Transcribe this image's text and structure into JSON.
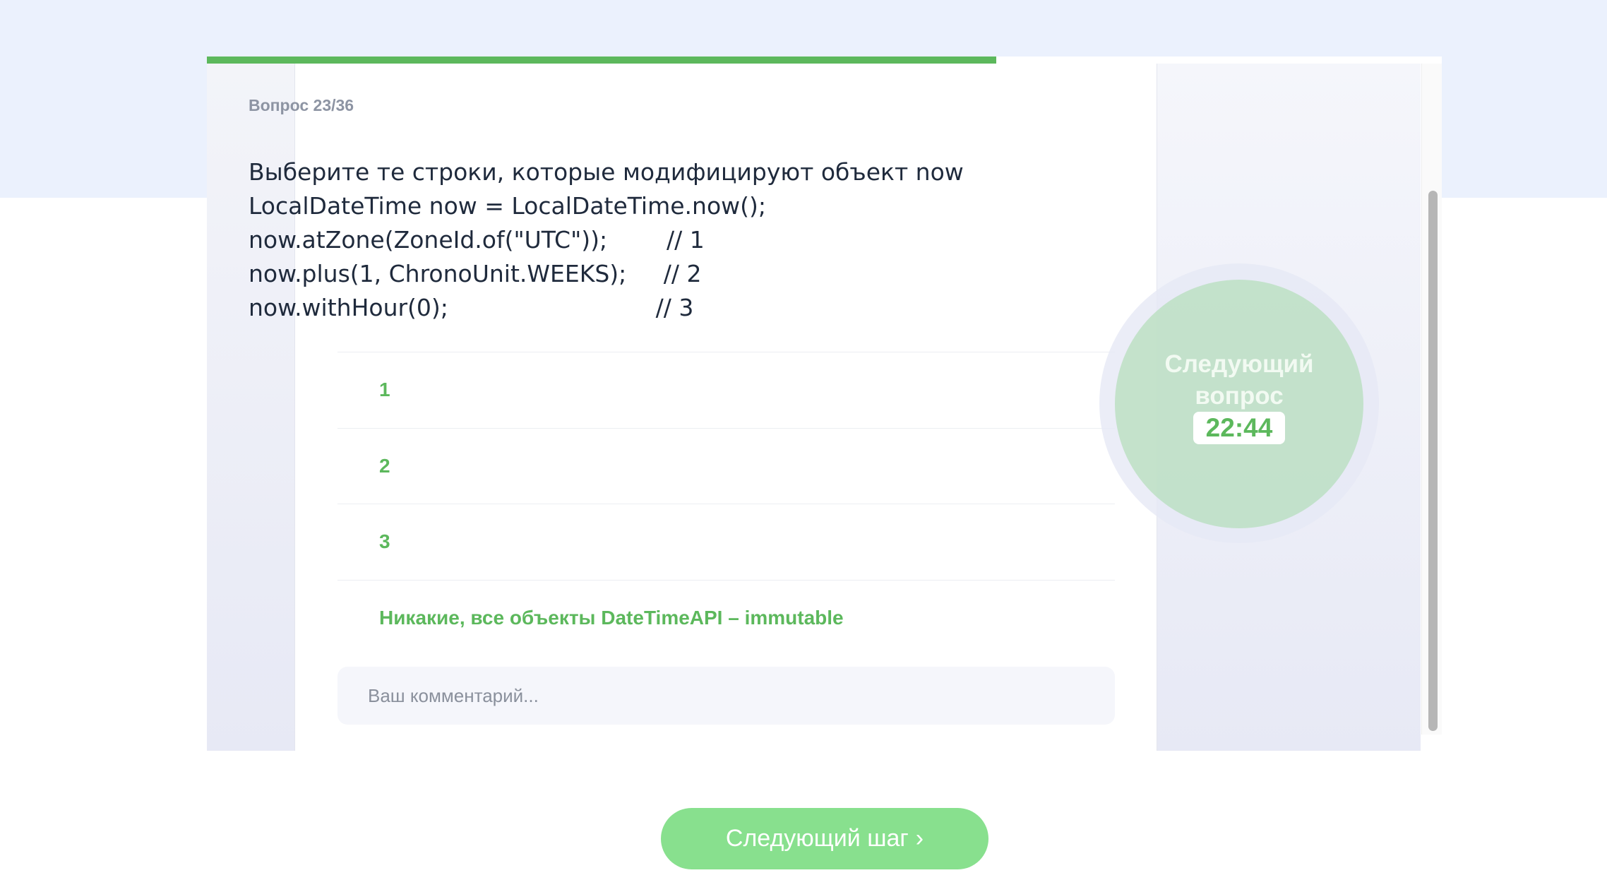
{
  "progress": {
    "fraction": 0.639
  },
  "question": {
    "counter": "Вопрос 23/36",
    "lines": [
      "Выберите те строки, которые модифицируют объект now",
      "LocalDateTime now = LocalDateTime.now();",
      "now.atZone(ZoneId.of(\"UTC\"));        // 1",
      "now.plus(1, ChronoUnit.WEEKS);     // 2",
      "now.withHour(0);                            // 3"
    ]
  },
  "answers": [
    {
      "label": "1"
    },
    {
      "label": "2"
    },
    {
      "label": "3"
    },
    {
      "label": "Никакие, все объекты DateTimeAPI – immutable"
    }
  ],
  "comment": {
    "placeholder": "Ваш комментарий..."
  },
  "timer": {
    "label": "Следующий вопрос",
    "time": "22:44"
  },
  "next_button": {
    "label": "Следующий шаг",
    "chevron": "›"
  },
  "colors": {
    "accent": "#5cb85c",
    "button": "#88e08e",
    "top_band": "#ebf1fd"
  }
}
